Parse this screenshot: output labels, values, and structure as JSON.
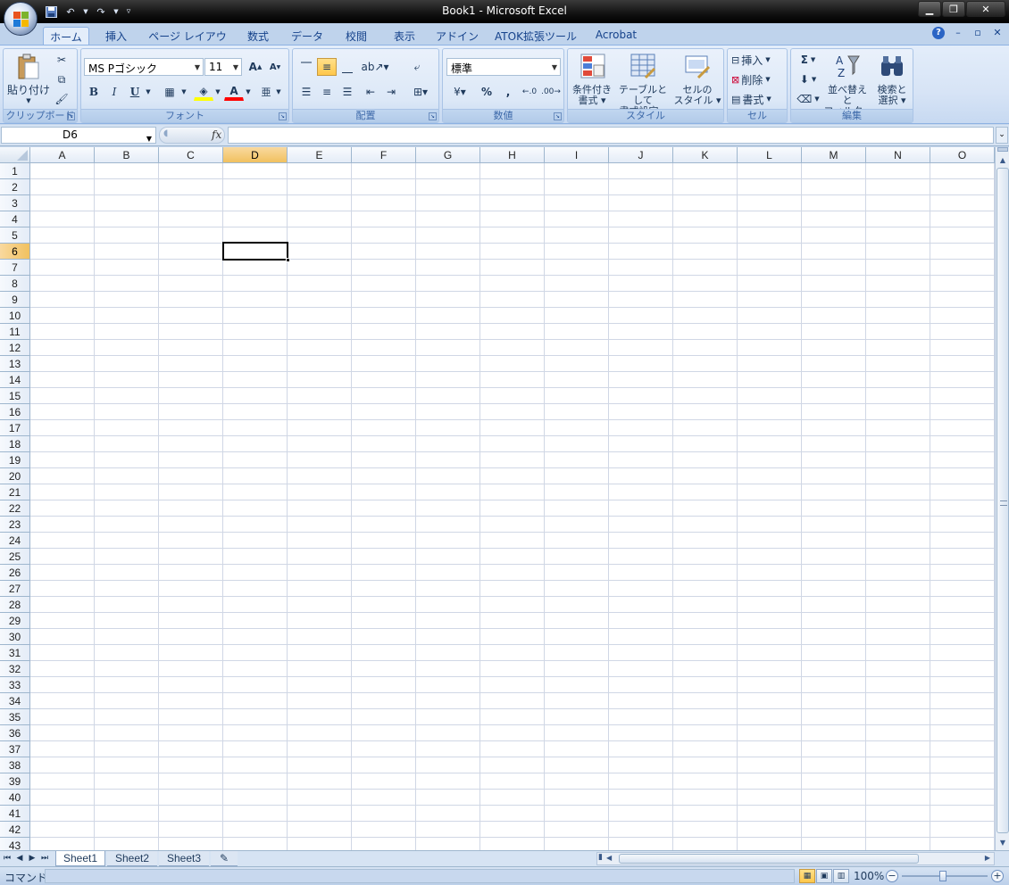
{
  "window": {
    "title": "Book1 - Microsoft Excel"
  },
  "qat": {
    "save_icon": "save-icon",
    "undo_icon": "undo-icon",
    "redo_icon": "redo-icon"
  },
  "tabs": [
    {
      "label": "ホーム",
      "active": true
    },
    {
      "label": "挿入"
    },
    {
      "label": "ページ レイアウト"
    },
    {
      "label": "数式"
    },
    {
      "label": "データ"
    },
    {
      "label": "校閲"
    },
    {
      "label": "表示"
    },
    {
      "label": "アドイン"
    },
    {
      "label": "ATOK拡張ツール"
    },
    {
      "label": "Acrobat"
    }
  ],
  "ribbon": {
    "clipboard": {
      "label": "クリップボード",
      "paste_label": "貼り付け"
    },
    "font": {
      "label": "フォント",
      "font_name": "MS Pゴシック",
      "font_size": "11",
      "bold": "B",
      "italic": "I",
      "underline": "U",
      "font_color_label": "A"
    },
    "alignment": {
      "label": "配置"
    },
    "number": {
      "label": "数値",
      "format": "標準",
      "percent": "%",
      "comma": ","
    },
    "styles": {
      "label": "スタイル",
      "conditional_line1": "条件付き",
      "conditional_line2": "書式",
      "table_line1": "テーブルとして",
      "table_line2": "書式設定",
      "cellstyle_line1": "セルの",
      "cellstyle_line2": "スタイル"
    },
    "cells": {
      "label": "セル",
      "insert": "挿入",
      "delete": "削除",
      "format": "書式"
    },
    "editing": {
      "label": "編集",
      "sum": "Σ",
      "sort_line1": "並べ替えと",
      "sort_line2": "フィルタ",
      "find_line1": "検索と",
      "find_line2": "選択"
    }
  },
  "formula_bar": {
    "name_box": "D6",
    "fx": "fx",
    "value": ""
  },
  "grid": {
    "columns": [
      "A",
      "B",
      "C",
      "D",
      "E",
      "F",
      "G",
      "H",
      "I",
      "J",
      "K",
      "L",
      "M",
      "N",
      "O"
    ],
    "rows": [
      "1",
      "2",
      "3",
      "4",
      "5",
      "6",
      "7",
      "8",
      "9",
      "10",
      "11",
      "12",
      "13",
      "14",
      "15",
      "16",
      "17",
      "18",
      "19",
      "20",
      "21",
      "22",
      "23",
      "24",
      "25",
      "26",
      "27",
      "28",
      "29",
      "30",
      "31",
      "32",
      "33",
      "34",
      "35",
      "36",
      "37",
      "38",
      "39",
      "40",
      "41",
      "42",
      "43"
    ],
    "selected_column": "D",
    "selected_row": "6"
  },
  "sheets": [
    "Sheet1",
    "Sheet2",
    "Sheet3"
  ],
  "status": {
    "mode": "コマンド",
    "zoom": "100%"
  },
  "colors": {
    "accent": "#15428b",
    "selection_header": "#f1c15f",
    "gridline": "#d0d7e5"
  }
}
